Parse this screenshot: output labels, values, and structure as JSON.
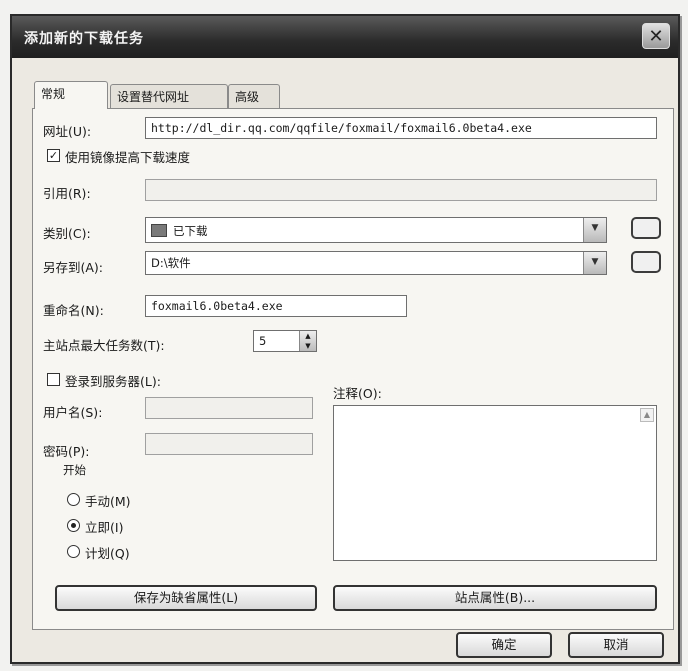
{
  "window": {
    "title": "添加新的下载任务",
    "close_glyph": "✕"
  },
  "tabs": [
    {
      "label": "常规"
    },
    {
      "label": "设置替代网址"
    },
    {
      "label": "高级"
    }
  ],
  "url": {
    "label": "网址(U):",
    "value": "http://dl_dir.qq.com/qqfile/foxmail/foxmail6.0beta4.exe"
  },
  "speedup": {
    "label": "使用镜像提高下载速度",
    "checked": true
  },
  "referrer": {
    "label": "引用(R):",
    "value": ""
  },
  "category": {
    "label": "类别(C):",
    "value": "已下载"
  },
  "save_to": {
    "label": "另存到(A):",
    "value": "D:\\软件"
  },
  "rename": {
    "label": "重命名(N):",
    "value": "foxmail6.0beta4.exe"
  },
  "connections": {
    "label": "主站点最大任务数(T):",
    "value": "5"
  },
  "login": {
    "label": "登录到服务器(L):",
    "checked": false
  },
  "username": {
    "label": "用户名(S):",
    "value": ""
  },
  "password": {
    "label": "密码(P):",
    "value": ""
  },
  "comment": {
    "label": "注释(O):"
  },
  "start": {
    "label": "开始",
    "options": [
      {
        "label": "手动(M)",
        "selected": false
      },
      {
        "label": "立即(I)",
        "selected": true
      },
      {
        "label": "计划(Q)",
        "selected": false
      }
    ]
  },
  "buttons": {
    "save_default": "保存为缺省属性(L)",
    "site_props": "站点属性(B)...",
    "ok": "确定",
    "cancel": "取消"
  }
}
